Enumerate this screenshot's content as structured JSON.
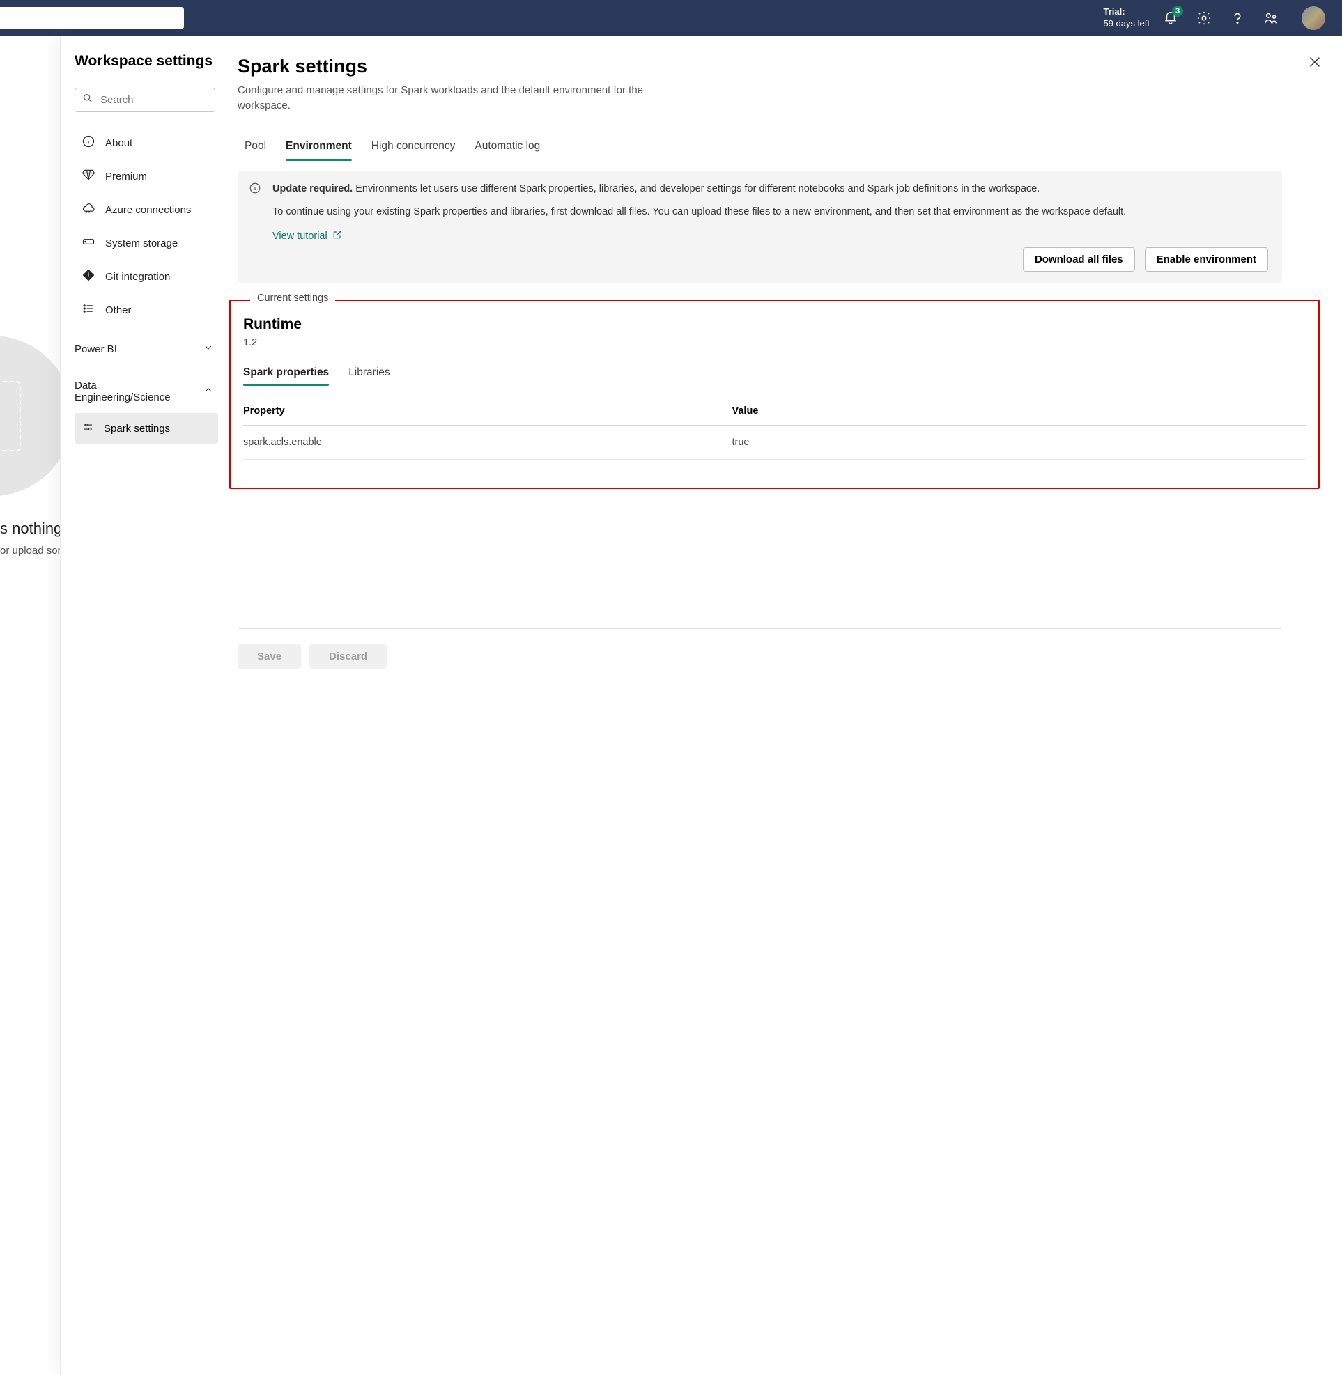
{
  "topbar": {
    "trial_label": "Trial:",
    "trial_remaining": "59 days left",
    "notification_count": "3"
  },
  "background": {
    "empty_title_fragment": "s nothing",
    "empty_subtitle_fragment": "or upload som"
  },
  "panel": {
    "title": "Workspace settings",
    "search_placeholder": "Search",
    "close_label": "Close"
  },
  "sidebar": {
    "items": [
      {
        "label": "About",
        "icon": "info"
      },
      {
        "label": "Premium",
        "icon": "diamond"
      },
      {
        "label": "Azure connections",
        "icon": "cloud"
      },
      {
        "label": "System storage",
        "icon": "storage"
      },
      {
        "label": "Git integration",
        "icon": "git"
      },
      {
        "label": "Other",
        "icon": "list"
      }
    ],
    "sections": [
      {
        "label": "Power BI",
        "expanded": false
      },
      {
        "label": "Data Engineering/Science",
        "expanded": true
      }
    ],
    "subitems": [
      {
        "label": "Spark settings",
        "active": true
      }
    ]
  },
  "main": {
    "title": "Spark settings",
    "description": "Configure and manage settings for Spark workloads and the default environment for the workspace.",
    "tabs": [
      {
        "label": "Pool",
        "active": false
      },
      {
        "label": "Environment",
        "active": true
      },
      {
        "label": "High concurrency",
        "active": false
      },
      {
        "label": "Automatic log",
        "active": false
      }
    ],
    "banner": {
      "bold_lead": "Update required.",
      "para1_rest": " Environments let users use different Spark properties, libraries, and developer settings for different notebooks and Spark job definitions in the workspace.",
      "para2": "To continue using your existing Spark properties and libraries, first download all files. You can upload these files to a new environment, and then set that environment as the workspace default.",
      "tutorial_label": "View tutorial",
      "button_download": "Download all files",
      "button_enable": "Enable environment"
    },
    "legend_label": "Current settings",
    "runtime": {
      "title": "Runtime",
      "version": "1.2",
      "subtabs": [
        {
          "label": "Spark properties",
          "active": true
        },
        {
          "label": "Libraries",
          "active": false
        }
      ],
      "table": {
        "header_property": "Property",
        "header_value": "Value",
        "rows": [
          {
            "property": "spark.acls.enable",
            "value": "true"
          }
        ]
      }
    },
    "footer": {
      "save": "Save",
      "discard": "Discard"
    }
  }
}
